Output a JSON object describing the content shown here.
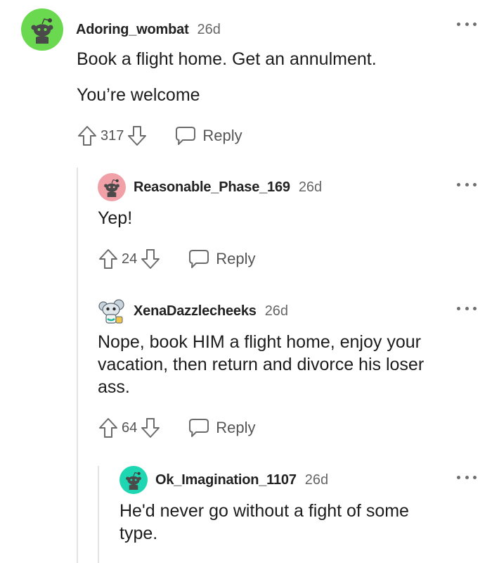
{
  "comments": [
    {
      "username": "Adoring_wombat",
      "time": "26d",
      "paragraphs": [
        "Book a flight home. Get an annulment.",
        "You’re welcome"
      ],
      "upvotes": "317",
      "reply_label": "Reply",
      "avatar": {
        "type": "snoo",
        "color": "#6bd94f"
      }
    },
    {
      "username": "Reasonable_Phase_169",
      "time": "26d",
      "paragraphs": [
        "Yep!"
      ],
      "upvotes": "24",
      "reply_label": "Reply",
      "avatar": {
        "type": "snoo",
        "color": "#f2a0a8"
      }
    },
    {
      "username": "XenaDazzlecheeks",
      "time": "26d",
      "paragraphs": [
        "Nope, book HIM a flight home, enjoy your vacation, then return and divorce his loser ass."
      ],
      "upvotes": "64",
      "reply_label": "Reply",
      "avatar": {
        "type": "custom-snoo",
        "color": "#c8d3dc"
      }
    },
    {
      "username": "Ok_Imagination_1107",
      "time": "26d",
      "paragraphs": [
        "He'd never go without a fight of some type."
      ],
      "avatar": {
        "type": "snoo",
        "color": "#1fd6b2"
      }
    }
  ]
}
